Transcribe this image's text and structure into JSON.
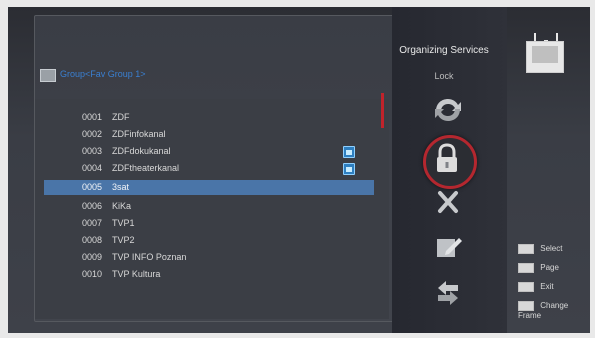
{
  "header": {
    "title": "Organizing Services",
    "subtitle": "Lock",
    "tv_icon": "tv-icon"
  },
  "group": {
    "label": "Group<Fav Group 1>"
  },
  "channels": [
    {
      "num": "0001",
      "name": "ZDF",
      "locked": false
    },
    {
      "num": "0002",
      "name": "ZDFinfokanal",
      "locked": false
    },
    {
      "num": "0003",
      "name": "ZDFdokukanal",
      "locked": true
    },
    {
      "num": "0004",
      "name": "ZDFtheaterkanal",
      "locked": true
    },
    {
      "num": "0005",
      "name": "3sat",
      "locked": false,
      "selected": true
    },
    {
      "num": "0006",
      "name": "KiKa",
      "locked": false
    },
    {
      "num": "0007",
      "name": "TVP1",
      "locked": false
    },
    {
      "num": "0008",
      "name": "TVP2",
      "locked": false
    },
    {
      "num": "0009",
      "name": "TVP INFO Poznan",
      "locked": false
    },
    {
      "num": "0010",
      "name": "TVP Kultura",
      "locked": false
    }
  ],
  "tools": [
    "move-icon",
    "lock-icon",
    "delete-icon",
    "rename-icon",
    "skip-icon"
  ],
  "legend": [
    {
      "key": "select-key",
      "label": "Select"
    },
    {
      "key": "page-key",
      "label": "Page"
    },
    {
      "key": "exit-key",
      "label": "Exit"
    },
    {
      "key": "frame-key",
      "label": "Change Frame"
    }
  ],
  "colors": {
    "accent": "#c0232b",
    "selection": "#4a75a8",
    "group_label": "#3a7fd1",
    "lock_badge": "#2e7fc0"
  }
}
